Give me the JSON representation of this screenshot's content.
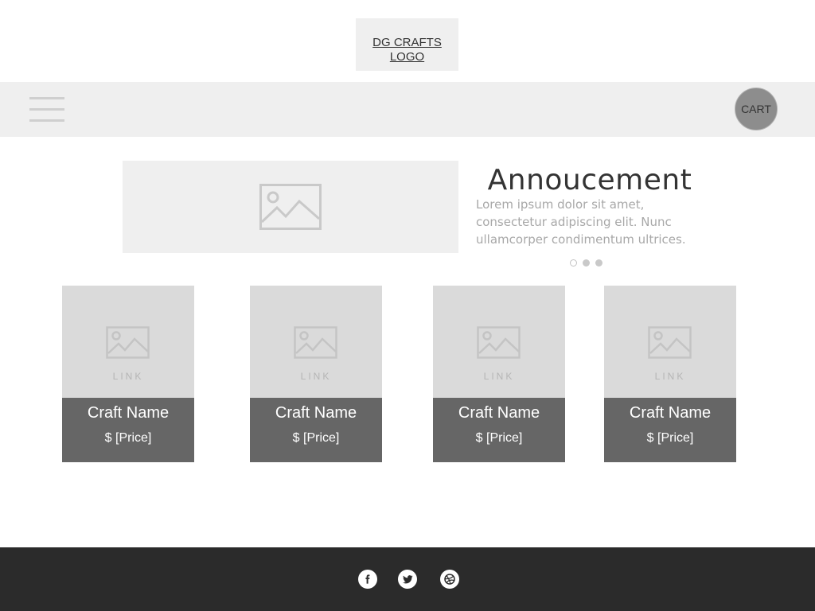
{
  "header": {
    "logo_text": "DG CRAFTS LOGO"
  },
  "nav": {
    "menu_icon": "hamburger-menu-icon",
    "cart_label": "CART"
  },
  "announcement": {
    "image_icon": "image-placeholder-icon",
    "title": "Annoucement",
    "body": "Lorem ipsum dolor sit amet, consectetur adipiscing elit. Nunc ullamcorper condimentum ultrices.",
    "carousel_dots": [
      "empty",
      "filled",
      "filled"
    ]
  },
  "products": [
    {
      "link_label": "LINK",
      "name": "Craft Name",
      "price": "$ [Price]"
    },
    {
      "link_label": "LINK",
      "name": "Craft Name",
      "price": "$ [Price]"
    },
    {
      "link_label": "LINK",
      "name": "Craft Name",
      "price": "$ [Price]"
    },
    {
      "link_label": "LINK",
      "name": "Craft Name",
      "price": "$ [Price]"
    }
  ],
  "footer": {
    "social": [
      "facebook-icon",
      "twitter-icon",
      "dribbble-icon"
    ]
  },
  "colors": {
    "nav_bg": "#efefef",
    "card_info_bg": "#666666",
    "footer_bg": "#2b2b2b",
    "cart_bg": "#8d8d8d"
  }
}
